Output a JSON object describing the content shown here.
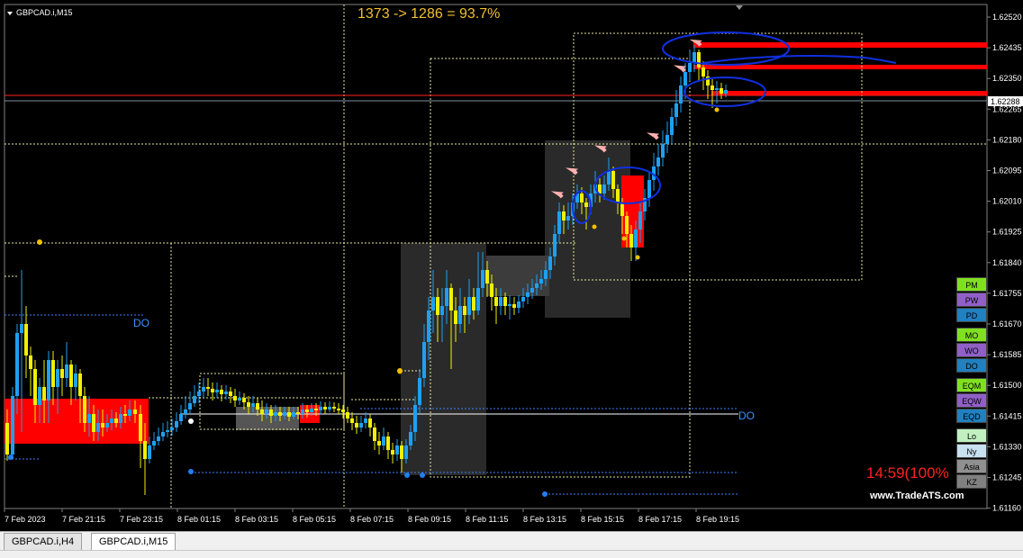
{
  "window": {
    "symbol_title": "GBPCAD.i,M15"
  },
  "indicator": {
    "ratio_text": "1373 -> 1286 = 93.7%",
    "countdown": "14:59(100%",
    "website": "www.TradeATS.com"
  },
  "price_axis": {
    "labels": [
      "1.62520",
      "1.62435",
      "1.62350",
      "1.62265",
      "1.62180",
      "1.62095",
      "1.62010",
      "1.61925",
      "1.61840",
      "1.61755",
      "1.61670",
      "1.61585",
      "1.61500",
      "1.61415",
      "1.61330",
      "1.61245",
      "1.61160"
    ],
    "current_price": "1.62288"
  },
  "time_axis": {
    "labels": [
      "7 Feb 2023",
      "7 Feb 21:15",
      "7 Feb 23:15",
      "8 Feb 01:15",
      "8 Feb 03:15",
      "8 Feb 05:15",
      "8 Feb 07:15",
      "8 Feb 09:15",
      "8 Feb 11:15",
      "8 Feb 13:15",
      "8 Feb 15:15",
      "8 Feb 17:15",
      "8 Feb 19:15"
    ]
  },
  "chart_labels": {
    "do_1": "DO",
    "do_2": "DO"
  },
  "panel_buttons": [
    {
      "label": "PM",
      "color": "#80e020"
    },
    {
      "label": "PW",
      "color": "#9060c8"
    },
    {
      "label": "PD",
      "color": "#2080c0"
    },
    {
      "label": "MO",
      "color": "#80e020"
    },
    {
      "label": "WO",
      "color": "#9060c8"
    },
    {
      "label": "DO",
      "color": "#2080c0"
    },
    {
      "label": "EQM",
      "color": "#80e020"
    },
    {
      "label": "EQW",
      "color": "#9060c8"
    },
    {
      "label": "EQD",
      "color": "#2080c0"
    },
    {
      "label": "Lo",
      "color": "#c0f0c0"
    },
    {
      "label": "Ny",
      "color": "#c8e0f0"
    },
    {
      "label": "Asia",
      "color": "#909090"
    },
    {
      "label": "KZ",
      "color": "#808080"
    }
  ],
  "tabs": [
    {
      "label": "GBPCAD.i,H4",
      "active": false
    },
    {
      "label": "GBPCAD.i,M15",
      "active": true
    }
  ],
  "colors": {
    "bull": "#1ea0f0",
    "bear": "#f0f000",
    "zone": "#ff0000",
    "grid": "#c8c880"
  }
}
